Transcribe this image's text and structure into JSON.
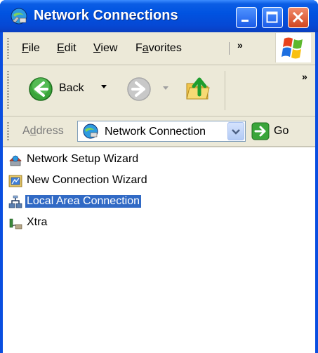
{
  "window": {
    "title": "Network Connections"
  },
  "menu": {
    "items": [
      {
        "label": "File",
        "key": "F",
        "rest": "ile"
      },
      {
        "label": "Edit",
        "key": "E",
        "rest": "dit"
      },
      {
        "label": "View",
        "key": "V",
        "rest": "iew"
      },
      {
        "label": "Favorites",
        "key_prefix": "F",
        "key": "a",
        "rest": "vorites"
      }
    ],
    "overflow": "»"
  },
  "toolbar": {
    "back_label": "Back",
    "overflow": "»"
  },
  "address": {
    "label_prefix": "A",
    "label_key": "d",
    "label_rest": "dress",
    "value": "Network Connection",
    "go_label": "Go"
  },
  "items": [
    {
      "label": "Network Setup Wizard",
      "icon": "network-setup-wizard-icon"
    },
    {
      "label": "New Connection Wizard",
      "icon": "new-connection-wizard-icon"
    },
    {
      "label": "Local Area Connection",
      "icon": "lan-connection-icon",
      "selected": true
    },
    {
      "label": "Xtra",
      "icon": "dialup-connection-icon"
    }
  ],
  "colors": {
    "title_blue": "#0053e1",
    "selection": "#316ac5",
    "chrome": "#ece9d8"
  }
}
